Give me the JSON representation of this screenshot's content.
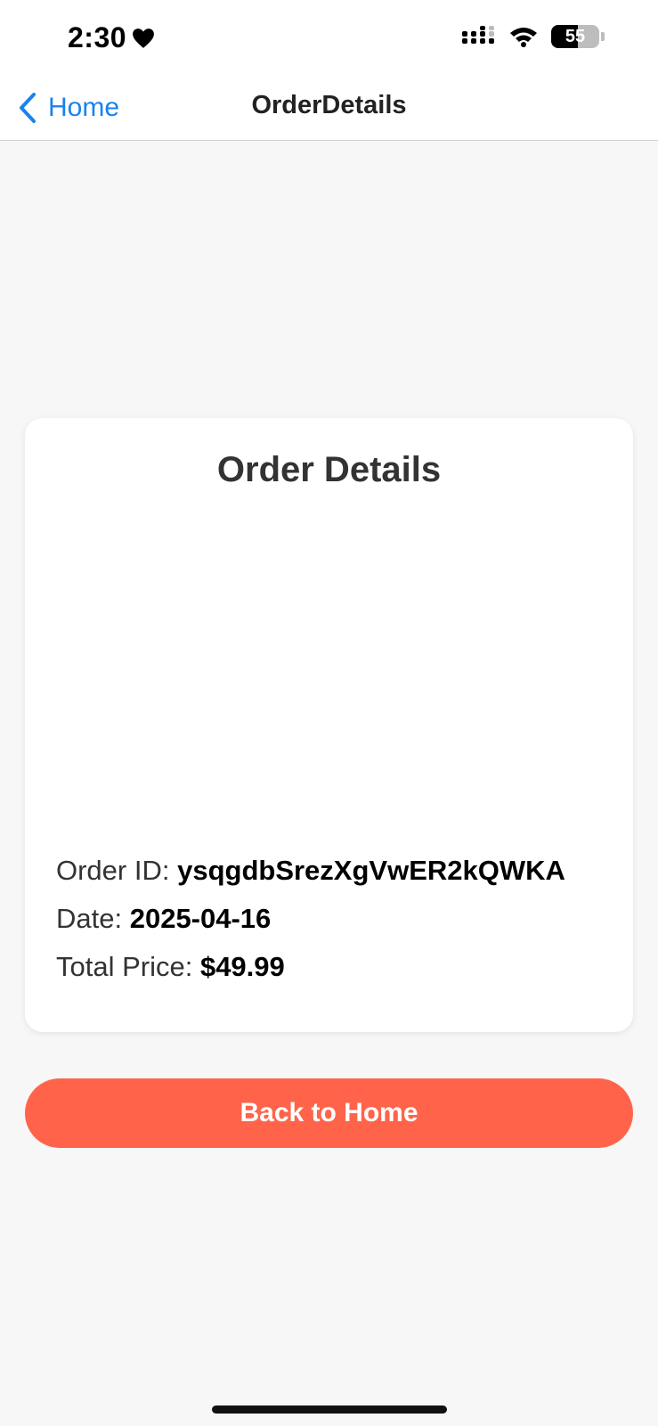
{
  "status_bar": {
    "time": "2:30",
    "battery_level": "55",
    "battery_fraction": 0.55
  },
  "nav": {
    "back_label": "Home",
    "title": "OrderDetails"
  },
  "card": {
    "title": "Order Details",
    "order_id_label": "Order ID: ",
    "order_id_value": "ysqgdbSrezXgVwER2kQWKA",
    "date_label": "Date: ",
    "date_value": "2025-04-16",
    "total_label": "Total Price: ",
    "total_value": "$49.99"
  },
  "action": {
    "back_home_label": "Back to Home"
  },
  "colors": {
    "accent": "#1a82f0",
    "button": "#ff644b",
    "background": "#f7f7f7"
  }
}
